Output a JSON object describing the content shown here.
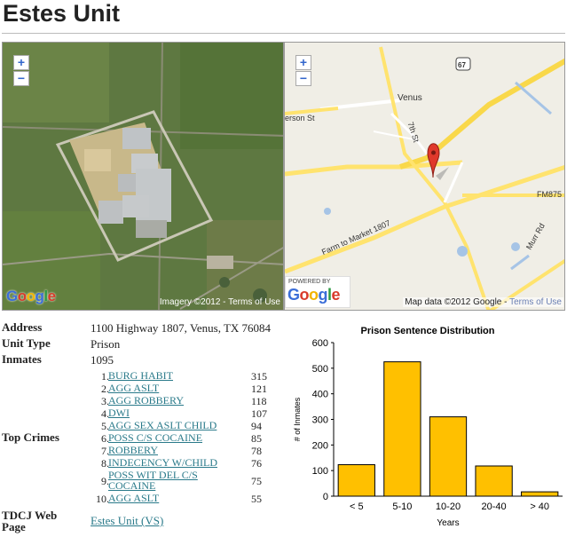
{
  "page": {
    "title": "Estes Unit"
  },
  "satellite_map": {
    "zoom_in": "+",
    "zoom_out": "−",
    "logo": "Google",
    "attribution": "Imagery ©2012 -",
    "terms": "Terms of Use"
  },
  "road_map": {
    "zoom_in": "+",
    "zoom_out": "−",
    "powered_by": "POWERED BY",
    "logo": "Google",
    "attribution": "Map data ©2012 Google -",
    "terms": "Terms of Use",
    "labels": {
      "venus": "Venus",
      "seventh": "7th St",
      "erson": "erson St",
      "fm875": "FM875",
      "fm1807": "Farm to Market 1807",
      "murr": "Murr Rd",
      "hwy67": "67"
    }
  },
  "info": {
    "address_label": "Address",
    "address": "1100 Highway 1807, Venus, TX 76084",
    "unit_type_label": "Unit Type",
    "unit_type": "Prison",
    "inmates_label": "Inmates",
    "inmates": "1095",
    "top_crimes_label": "Top Crimes",
    "web_label_1": "TDCJ Web",
    "web_label_2": "Page",
    "web_link": "Estes Unit (VS)"
  },
  "top_crimes": [
    {
      "rank": "1.",
      "name": "BURG HABIT",
      "count": "315"
    },
    {
      "rank": "2.",
      "name": "AGG ASLT",
      "count": "121"
    },
    {
      "rank": "3.",
      "name": "AGG ROBBERY",
      "count": "118"
    },
    {
      "rank": "4.",
      "name": "DWI",
      "count": "107"
    },
    {
      "rank": "5.",
      "name": "AGG SEX ASLT CHILD",
      "count": "94"
    },
    {
      "rank": "6.",
      "name": "POSS C/S COCAINE",
      "count": "85"
    },
    {
      "rank": "7.",
      "name": "ROBBERY",
      "count": "78"
    },
    {
      "rank": "8.",
      "name": "INDECENCY W/CHILD",
      "count": "76"
    },
    {
      "rank": "9.",
      "name": "POSS WIT DEL C/S COCAINE",
      "count": "75"
    },
    {
      "rank": "10.",
      "name": "AGG ASLT",
      "count": "55"
    }
  ],
  "chart_data": {
    "type": "bar",
    "title": "Prison Sentence Distribution",
    "xlabel": "Years",
    "ylabel": "# of Inmates",
    "categories": [
      "< 5",
      "5-10",
      "10-20",
      "20-40",
      "> 40"
    ],
    "values": [
      123,
      525,
      310,
      118,
      17
    ],
    "ylim": [
      0,
      600
    ],
    "yticks": [
      "0",
      "100",
      "200",
      "300",
      "400",
      "500",
      "600"
    ],
    "bar_color": "#ffc000",
    "grid": false,
    "legend": "none"
  }
}
